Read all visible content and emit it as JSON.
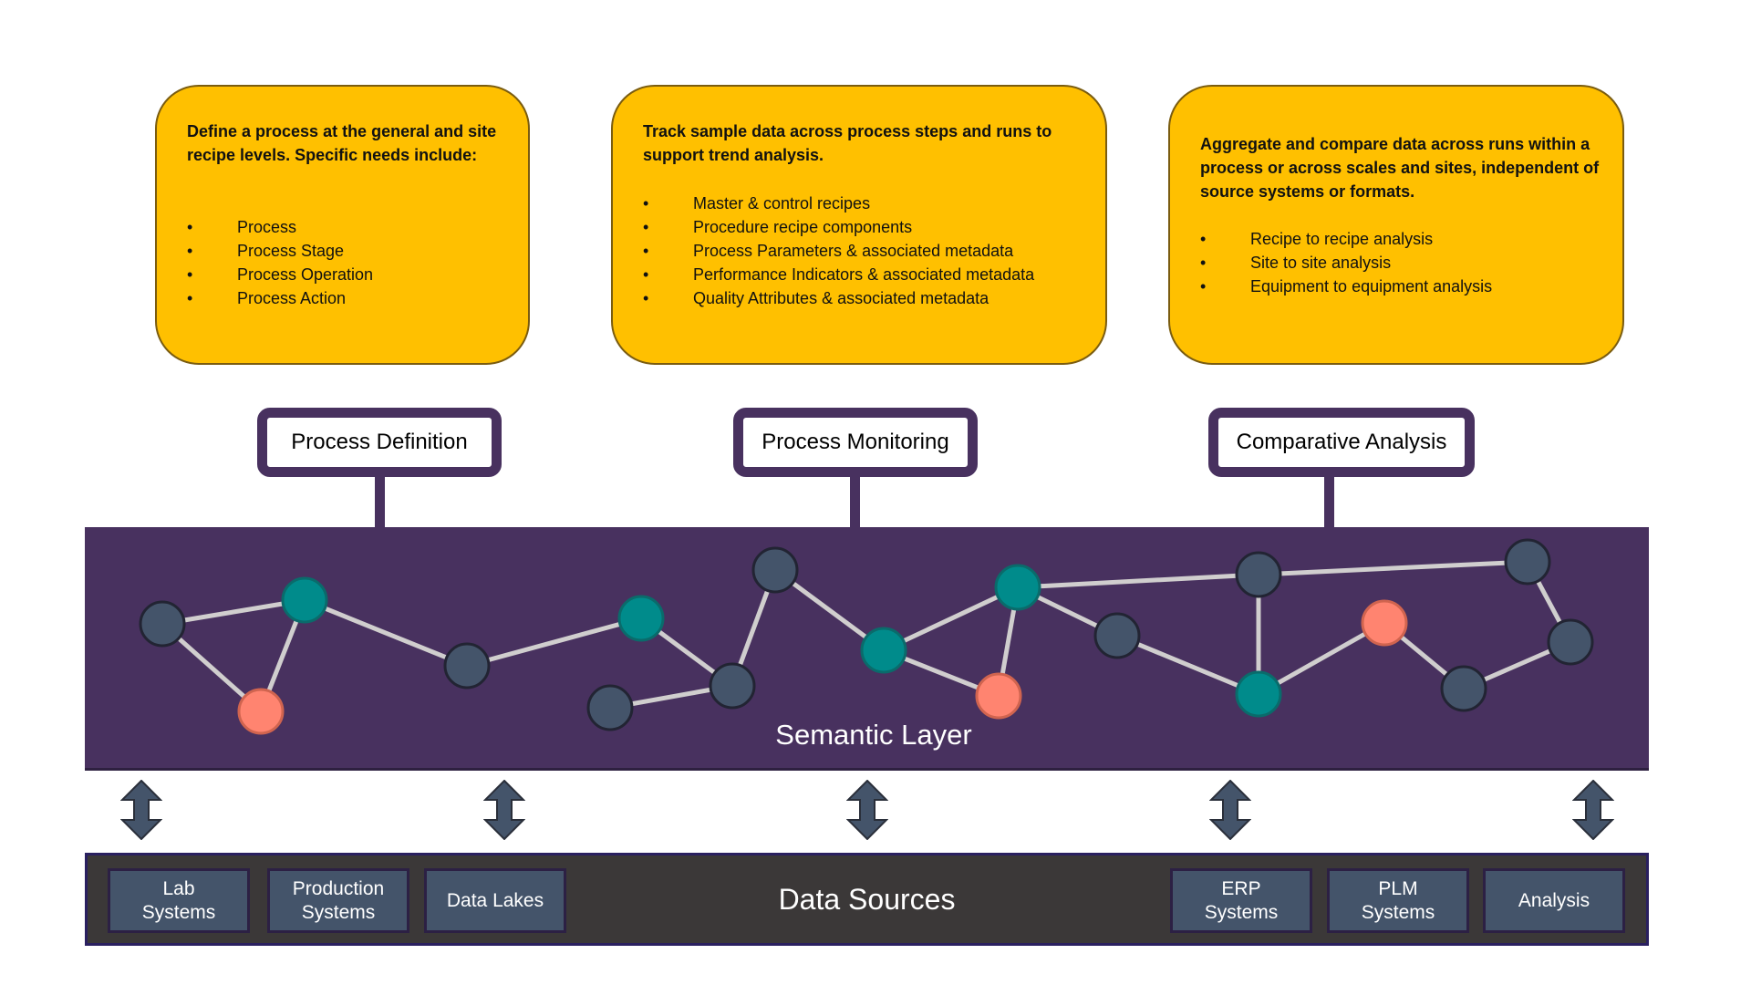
{
  "colors": {
    "card_fill": "#FFC000",
    "card_border": "#7a5c10",
    "purple": "#48315F",
    "node_slate": "#44546A",
    "node_teal": "#008B8B",
    "node_coral": "#FF8470",
    "edge": "#D0CECE",
    "sources_bg": "#3B3838"
  },
  "cards": [
    {
      "intro": "Define a process at the general and site recipe levels. Specific needs include:",
      "items": [
        "Process",
        "Process Stage",
        "Process Operation",
        "Process Action"
      ]
    },
    {
      "intro": "Track sample data across process steps and runs to support trend analysis.",
      "items": [
        "Master & control recipes",
        "Procedure recipe components",
        "Process Parameters & associated metadata",
        "Performance Indicators & associated metadata",
        "Quality Attributes & associated metadata"
      ]
    },
    {
      "intro": "Aggregate and compare data across runs within a process or across scales and sites, independent of source systems or formats.",
      "items": [
        "Recipe to recipe analysis",
        "Site to site analysis",
        "Equipment to equipment analysis"
      ]
    }
  ],
  "bullet_glyph": "•",
  "capabilities": [
    "Process Definition",
    "Process Monitoring",
    "Comparative Analysis"
  ],
  "semantic_layer": {
    "title": "Semantic Layer",
    "nodes": [
      {
        "id": "n1",
        "type": "slate"
      },
      {
        "id": "n2",
        "type": "teal"
      },
      {
        "id": "n3",
        "type": "coral"
      },
      {
        "id": "n4",
        "type": "slate"
      },
      {
        "id": "n5",
        "type": "teal"
      },
      {
        "id": "n6",
        "type": "slate"
      },
      {
        "id": "n7",
        "type": "slate"
      },
      {
        "id": "n8",
        "type": "slate"
      },
      {
        "id": "n9",
        "type": "teal"
      },
      {
        "id": "n10",
        "type": "teal"
      },
      {
        "id": "n11",
        "type": "coral"
      },
      {
        "id": "n12",
        "type": "slate"
      },
      {
        "id": "n13",
        "type": "slate"
      },
      {
        "id": "n14",
        "type": "teal"
      },
      {
        "id": "n15",
        "type": "coral"
      },
      {
        "id": "n16",
        "type": "slate"
      },
      {
        "id": "n17",
        "type": "slate"
      },
      {
        "id": "n18",
        "type": "slate"
      }
    ],
    "edges": [
      [
        "n1",
        "n2"
      ],
      [
        "n1",
        "n3"
      ],
      [
        "n2",
        "n3"
      ],
      [
        "n2",
        "n4"
      ],
      [
        "n4",
        "n5"
      ],
      [
        "n5",
        "n6"
      ],
      [
        "n7",
        "n6"
      ],
      [
        "n6",
        "n8"
      ],
      [
        "n8",
        "n9"
      ],
      [
        "n9",
        "n10"
      ],
      [
        "n9",
        "n11"
      ],
      [
        "n10",
        "n11"
      ],
      [
        "n10",
        "n12"
      ],
      [
        "n10",
        "n13"
      ],
      [
        "n12",
        "n14"
      ],
      [
        "n13",
        "n14"
      ],
      [
        "n14",
        "n15"
      ],
      [
        "n15",
        "n16"
      ],
      [
        "n13",
        "n17"
      ],
      [
        "n17",
        "n18"
      ],
      [
        "n18",
        "n16"
      ]
    ]
  },
  "data_sources": {
    "title": "Data Sources",
    "items": [
      "Lab\nSystems",
      "Production\nSystems",
      "Data Lakes",
      "ERP\nSystems",
      "PLM\nSystems",
      "Analysis"
    ]
  }
}
